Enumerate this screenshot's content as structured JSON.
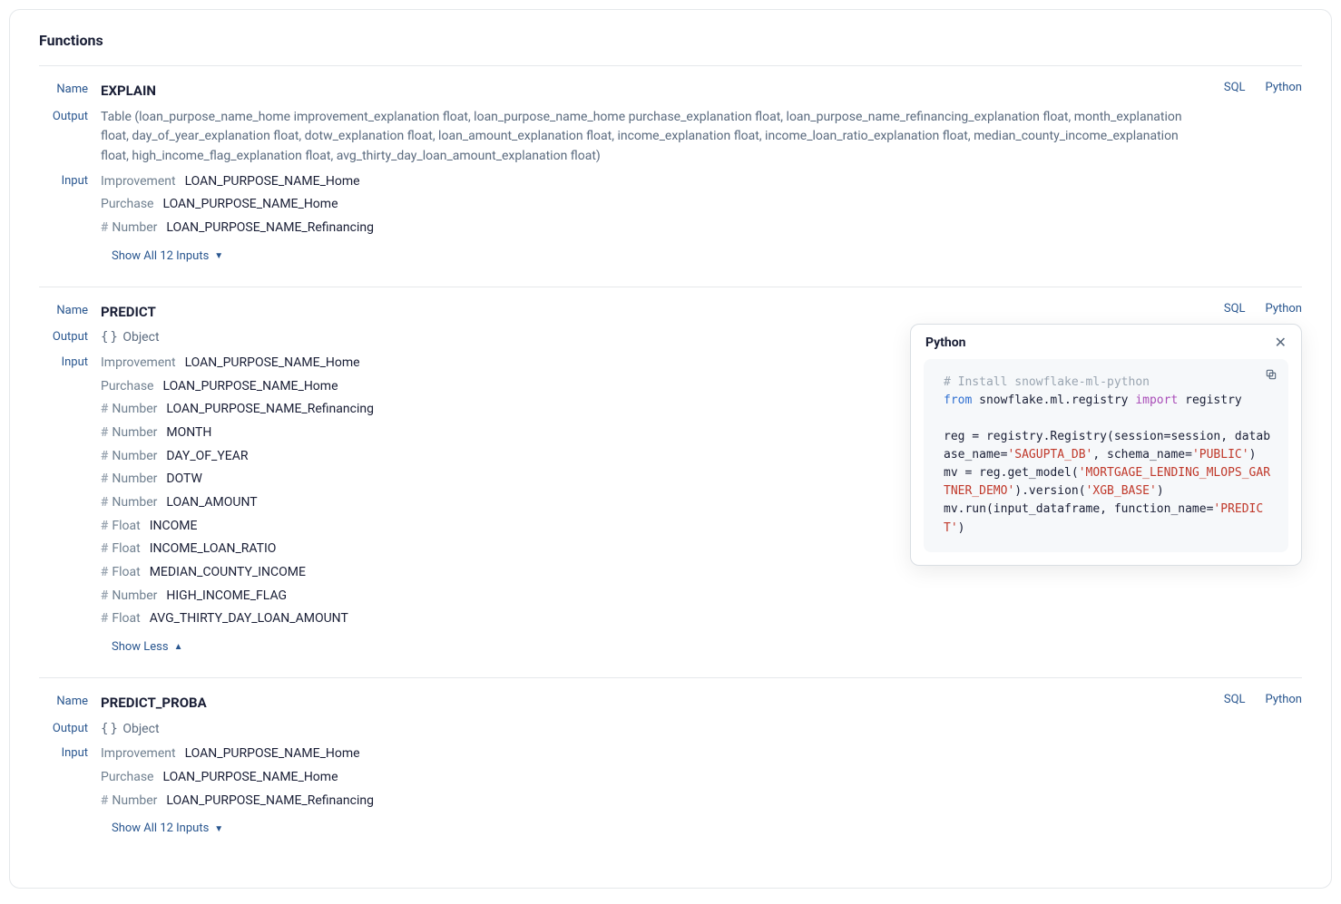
{
  "page_title": "Functions",
  "labels": {
    "name": "Name",
    "output": "Output",
    "input": "Input",
    "sql": "SQL",
    "python": "Python",
    "show_all": "Show All 12 Inputs",
    "show_less": "Show Less",
    "object": "Object"
  },
  "popover": {
    "title": "Python",
    "code": {
      "line1_comment": "# Install snowflake-ml-python",
      "line2_from": "from",
      "line2_module": " snowflake.ml.registry ",
      "line2_import": "import",
      "line2_name": " registry",
      "line4a": "reg = registry.Registry(session=session, database_name=",
      "line4b": "'SAGUPTA_DB'",
      "line4c": ", schema_name=",
      "line4d": "'PUBLIC'",
      "line4e": ")",
      "line5": "mv = reg.get_model(",
      "line5b": "'MORTGAGE_LENDING_MLOPS_GARTNER_DEMO'",
      "line5c": ").version(",
      "line5d": "'XGB_BASE'",
      "line5e": ")",
      "line6a": "mv.run(input_dataframe, function_name=",
      "line6b": "'PREDICT'",
      "line6c": ")"
    }
  },
  "functions": [
    {
      "name": "EXPLAIN",
      "output_kind": "table",
      "output_text": "Table (loan_purpose_name_home improvement_explanation float, loan_purpose_name_home purchase_explanation float, loan_purpose_name_refinancing_explanation float, month_explanation float, day_of_year_explanation float, dotw_explanation float, loan_amount_explanation float, income_explanation float, income_loan_ratio_explanation float, median_county_income_explanation float, high_income_flag_explanation float, avg_thirty_day_loan_amount_explanation float)",
      "expanded": false,
      "inputs": [
        {
          "type": "Improvement",
          "name": "LOAN_PURPOSE_NAME_Home"
        },
        {
          "type": "Purchase",
          "name": "LOAN_PURPOSE_NAME_Home"
        },
        {
          "type": "Number",
          "hash": true,
          "name": "LOAN_PURPOSE_NAME_Refinancing"
        }
      ]
    },
    {
      "name": "PREDICT",
      "output_kind": "object",
      "expanded": true,
      "show_popover": true,
      "inputs": [
        {
          "type": "Improvement",
          "name": "LOAN_PURPOSE_NAME_Home"
        },
        {
          "type": "Purchase",
          "name": "LOAN_PURPOSE_NAME_Home"
        },
        {
          "type": "Number",
          "hash": true,
          "name": "LOAN_PURPOSE_NAME_Refinancing"
        },
        {
          "type": "Number",
          "hash": true,
          "name": "MONTH"
        },
        {
          "type": "Number",
          "hash": true,
          "name": "DAY_OF_YEAR"
        },
        {
          "type": "Number",
          "hash": true,
          "name": "DOTW"
        },
        {
          "type": "Number",
          "hash": true,
          "name": "LOAN_AMOUNT"
        },
        {
          "type": "Float",
          "hash": true,
          "name": "INCOME"
        },
        {
          "type": "Float",
          "hash": true,
          "name": "INCOME_LOAN_RATIO"
        },
        {
          "type": "Float",
          "hash": true,
          "name": "MEDIAN_COUNTY_INCOME"
        },
        {
          "type": "Number",
          "hash": true,
          "name": "HIGH_INCOME_FLAG"
        },
        {
          "type": "Float",
          "hash": true,
          "name": "AVG_THIRTY_DAY_LOAN_AMOUNT"
        }
      ]
    },
    {
      "name": "PREDICT_PROBA",
      "output_kind": "object",
      "expanded": false,
      "inputs": [
        {
          "type": "Improvement",
          "name": "LOAN_PURPOSE_NAME_Home"
        },
        {
          "type": "Purchase",
          "name": "LOAN_PURPOSE_NAME_Home"
        },
        {
          "type": "Number",
          "hash": true,
          "name": "LOAN_PURPOSE_NAME_Refinancing"
        }
      ]
    }
  ]
}
